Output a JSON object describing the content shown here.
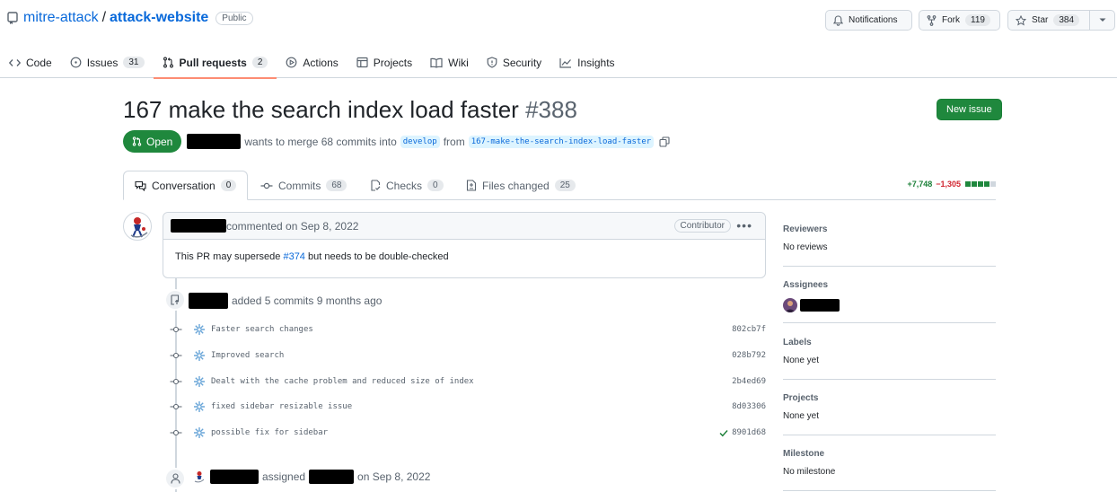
{
  "repo": {
    "owner": "mitre-attack",
    "name": "attack-website",
    "visibility": "Public",
    "notifications_label": "Notifications",
    "fork_label": "Fork",
    "fork_count": "119",
    "star_label": "Star",
    "star_count": "384"
  },
  "nav_tabs": [
    {
      "label": "Code",
      "icon": "code-icon"
    },
    {
      "label": "Issues",
      "count": "31",
      "icon": "issue-opened-icon"
    },
    {
      "label": "Pull requests",
      "count": "2",
      "icon": "git-pull-request-icon",
      "active": true
    },
    {
      "label": "Actions",
      "icon": "play-icon"
    },
    {
      "label": "Projects",
      "icon": "table-icon"
    },
    {
      "label": "Wiki",
      "icon": "book-icon"
    },
    {
      "label": "Security",
      "icon": "shield-icon"
    },
    {
      "label": "Insights",
      "icon": "graph-icon"
    }
  ],
  "pr": {
    "title": "167 make the search index load faster",
    "number": "#388",
    "new_issue_label": "New issue",
    "state": "Open",
    "merge_text": "wants to merge 68 commits into",
    "base_branch": "develop",
    "from_text": "from",
    "head_branch": "167-make-the-search-index-load-faster"
  },
  "pr_tabs": [
    {
      "label": "Conversation",
      "count": "0",
      "icon": "comment-discussion-icon"
    },
    {
      "label": "Commits",
      "count": "68",
      "icon": "git-commit-icon"
    },
    {
      "label": "Checks",
      "count": "0",
      "icon": "checklist-icon"
    },
    {
      "label": "Files changed",
      "count": "25",
      "icon": "file-diff-icon"
    }
  ],
  "diffstat": {
    "additions": "+7,748",
    "deletions": "−1,305"
  },
  "comment": {
    "action": "commented on Sep 8, 2022",
    "badge": "Contributor",
    "body_prefix": "This PR may supersede",
    "body_link": "#374",
    "body_suffix": "but needs to be double-checked"
  },
  "commits_event": {
    "text": "added 5 commits 9 months ago",
    "commits": [
      {
        "message": "Faster search changes",
        "sha": "802cb7f",
        "verified": false
      },
      {
        "message": "Improved search",
        "sha": "028b792",
        "verified": false
      },
      {
        "message": "Dealt with the cache problem and reduced size of index",
        "sha": "2b4ed69",
        "verified": false
      },
      {
        "message": "fixed sidebar resizable issue",
        "sha": "8d03306",
        "verified": false
      },
      {
        "message": "possible fix for sidebar",
        "sha": "8901d68",
        "verified": true
      }
    ]
  },
  "assign_event": {
    "assigned": "assigned",
    "date": "on Sep 8, 2022"
  },
  "sidebar": {
    "reviewers": {
      "heading": "Reviewers",
      "value": "No reviews"
    },
    "assignees": {
      "heading": "Assignees"
    },
    "labels": {
      "heading": "Labels",
      "value": "None yet"
    },
    "projects": {
      "heading": "Projects",
      "value": "None yet"
    },
    "milestone": {
      "heading": "Milestone",
      "value": "No milestone"
    }
  },
  "colors": {
    "accent": "#0969da",
    "open": "#1f883d",
    "add": "#1a7f37",
    "del": "#d1242f",
    "tab_underline": "#fd8c73"
  }
}
